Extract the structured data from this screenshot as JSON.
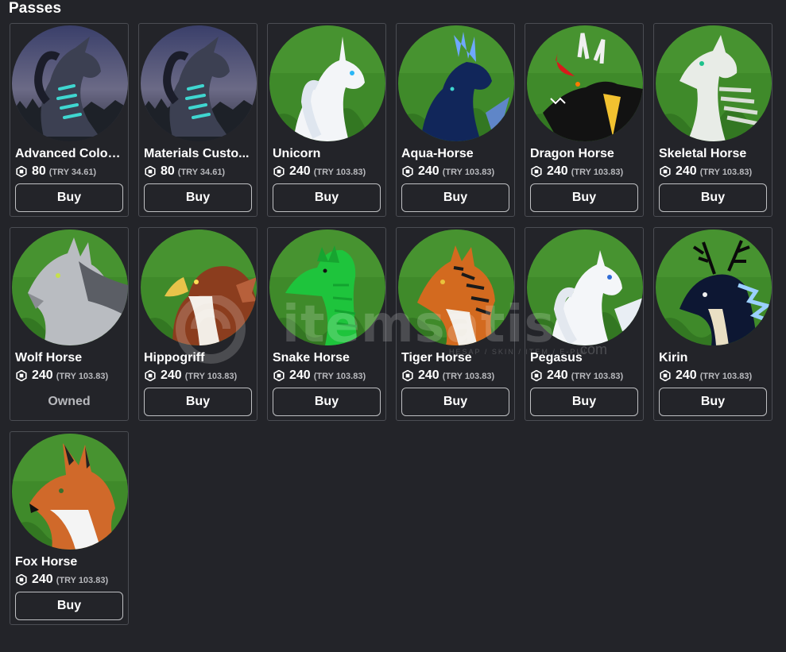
{
  "section": {
    "title": "Passes"
  },
  "watermark": {
    "main": "itemsatis",
    "sub": "HESAP / SKIN / ITEM / E-PIN",
    "suffix": ".com"
  },
  "passes": [
    {
      "name": "Advanced Color ...",
      "price": "80",
      "local_price": "(TRY 34.61)",
      "action": "Buy",
      "owned": false,
      "art": "night"
    },
    {
      "name": "Materials Custo...",
      "price": "80",
      "local_price": "(TRY 34.61)",
      "action": "Buy",
      "owned": false,
      "art": "night"
    },
    {
      "name": "Unicorn",
      "price": "240",
      "local_price": "(TRY 103.83)",
      "action": "Buy",
      "owned": false,
      "art": "unicorn"
    },
    {
      "name": "Aqua-Horse",
      "price": "240",
      "local_price": "(TRY 103.83)",
      "action": "Buy",
      "owned": false,
      "art": "aqua"
    },
    {
      "name": "Dragon Horse",
      "price": "240",
      "local_price": "(TRY 103.83)",
      "action": "Buy",
      "owned": false,
      "art": "dragon"
    },
    {
      "name": "Skeletal Horse",
      "price": "240",
      "local_price": "(TRY 103.83)",
      "action": "Buy",
      "owned": false,
      "art": "skeletal"
    },
    {
      "name": "Wolf Horse",
      "price": "240",
      "local_price": "(TRY 103.83)",
      "action": "Owned",
      "owned": true,
      "art": "wolf"
    },
    {
      "name": "Hippogriff",
      "price": "240",
      "local_price": "(TRY 103.83)",
      "action": "Buy",
      "owned": false,
      "art": "hippogriff"
    },
    {
      "name": "Snake Horse",
      "price": "240",
      "local_price": "(TRY 103.83)",
      "action": "Buy",
      "owned": false,
      "art": "snake"
    },
    {
      "name": "Tiger Horse",
      "price": "240",
      "local_price": "(TRY 103.83)",
      "action": "Buy",
      "owned": false,
      "art": "tiger"
    },
    {
      "name": "Pegasus",
      "price": "240",
      "local_price": "(TRY 103.83)",
      "action": "Buy",
      "owned": false,
      "art": "pegasus"
    },
    {
      "name": "Kirin",
      "price": "240",
      "local_price": "(TRY 103.83)",
      "action": "Buy",
      "owned": false,
      "art": "kirin"
    },
    {
      "name": "Fox Horse",
      "price": "240",
      "local_price": "(TRY 103.83)",
      "action": "Buy",
      "owned": false,
      "art": "fox"
    }
  ],
  "colors": {
    "background": "#232429",
    "card_border": "#4b4d53",
    "button_border": "#bfc0c3",
    "muted_text": "#b8b9bd",
    "grass": "#3f8a2a"
  }
}
